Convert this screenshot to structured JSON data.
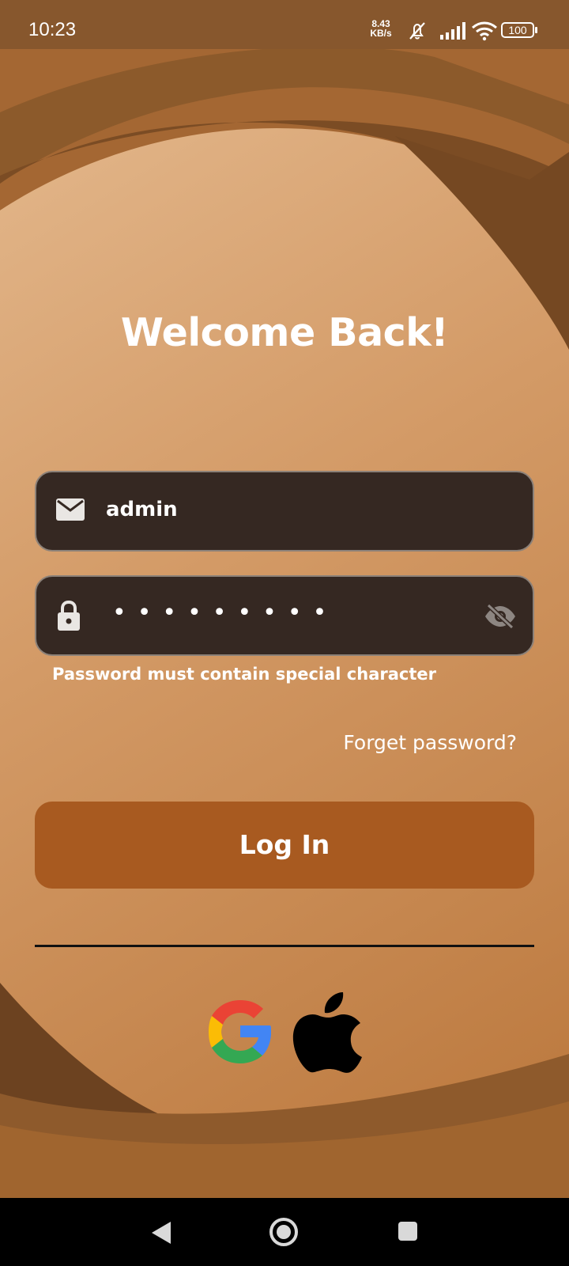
{
  "status_bar": {
    "time": "10:23",
    "net_speed_value": "8.43",
    "net_speed_unit": "KB/s",
    "battery": "100"
  },
  "login": {
    "title": "Welcome Back!",
    "email_value": "admin",
    "password_mask": "•••••••••",
    "password_error": "Password must contain special character",
    "forgot_password": "Forget password?",
    "login_button": "Log In"
  },
  "social": {
    "providers": [
      "google-icon",
      "apple-icon"
    ]
  },
  "colors": {
    "status_bar": "#87572d",
    "field_bg": "#352822",
    "button_bg": "#a85a20",
    "bg_light": "#e2b88e",
    "bg_dark": "#764a24"
  },
  "icons": {
    "email": "mail-icon",
    "password": "lock-icon",
    "toggle_visibility": "eye-off-icon",
    "nav_back": "back-triangle-icon",
    "nav_home": "home-circle-icon",
    "nav_recents": "recents-square-icon"
  }
}
